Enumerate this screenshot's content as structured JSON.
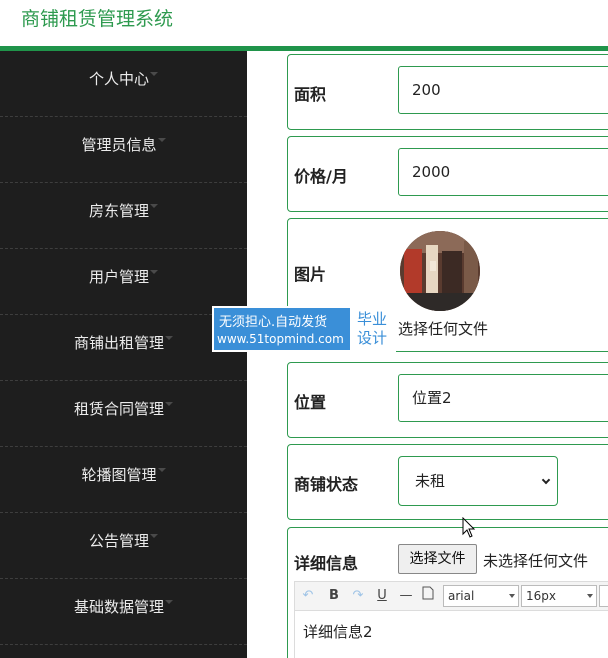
{
  "app": {
    "title": "商铺租赁管理系统"
  },
  "sidebar": {
    "items": [
      {
        "label": "个人中心"
      },
      {
        "label": "管理员信息"
      },
      {
        "label": "房东管理"
      },
      {
        "label": "用户管理"
      },
      {
        "label": "商铺出租管理"
      },
      {
        "label": "租赁合同管理"
      },
      {
        "label": "轮播图管理"
      },
      {
        "label": "公告管理"
      },
      {
        "label": "基础数据管理"
      }
    ]
  },
  "form": {
    "area": {
      "label": "面积",
      "value": "200"
    },
    "price": {
      "label": "价格/月",
      "value": "2000"
    },
    "image": {
      "label": "图片",
      "file_status": "选择任何文件"
    },
    "location": {
      "label": "位置",
      "value": "位置2"
    },
    "status": {
      "label": "商铺状态",
      "selected": "未租"
    },
    "details": {
      "label": "详细信息",
      "file_button": "选择文件",
      "file_status": "未选择任何文件",
      "toolbar": {
        "bold": "B",
        "underline": "U",
        "font": "arial",
        "size": "16px"
      },
      "content": "详细信息2"
    }
  },
  "watermark": {
    "line1": "无须担心.自动发货",
    "line2": "www.51topmind.com",
    "right1": "毕业",
    "right2": "设计"
  },
  "colors": {
    "accent": "#2e9a4f",
    "sidebar_bg": "#1e1e1e",
    "watermark": "#3a8fd8"
  }
}
